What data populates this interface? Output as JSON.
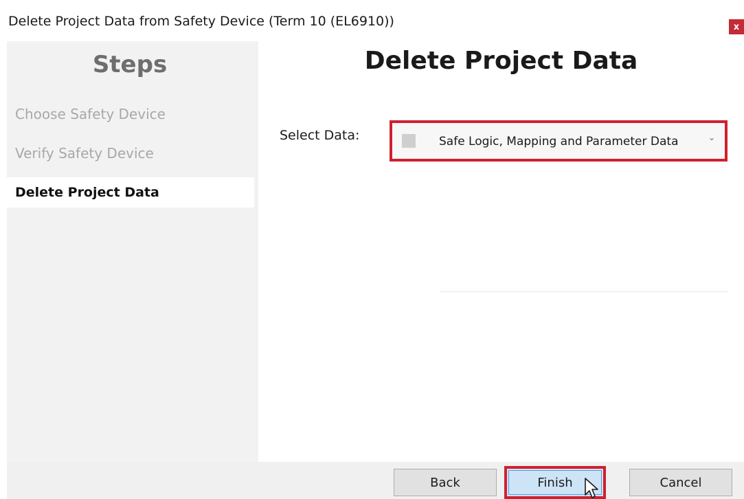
{
  "window": {
    "title": "Delete Project Data from Safety Device (Term 10 (EL6910))",
    "close_label": "x"
  },
  "sidebar": {
    "heading": "Steps",
    "steps": [
      {
        "label": "Choose Safety Device",
        "state": "disabled"
      },
      {
        "label": "Verify Safety Device",
        "state": "disabled"
      },
      {
        "label": "Delete Project Data",
        "state": "active"
      }
    ]
  },
  "main": {
    "heading": "Delete Project Data",
    "select_label": "Select Data:",
    "select_value": "Safe Logic, Mapping and Parameter Data"
  },
  "buttons": {
    "back": "Back",
    "finish": "Finish",
    "cancel": "Cancel"
  },
  "colors": {
    "highlight": "#d0202e",
    "close_button": "#c42b36",
    "finish_fill": "#cde4f7"
  },
  "icons": {
    "close": "close-icon",
    "chevron": "chevron-down-icon",
    "cursor": "mouse-pointer-icon"
  }
}
